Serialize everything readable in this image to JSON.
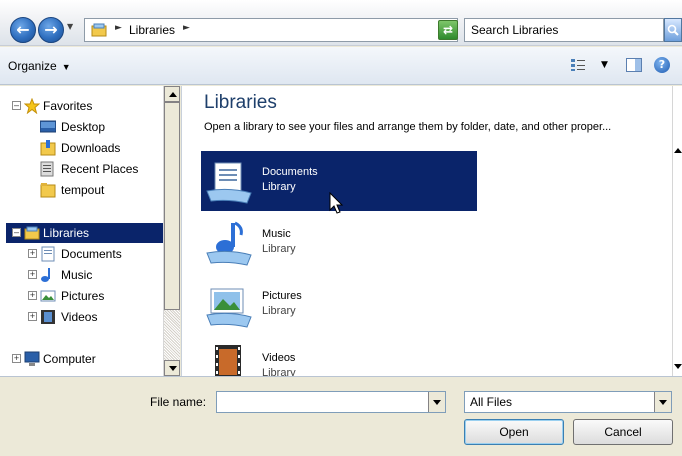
{
  "address": {
    "path_label": "Libraries",
    "search_placeholder": "Search Libraries"
  },
  "toolbar": {
    "organize_label": "Organize"
  },
  "nav": {
    "items": [
      {
        "label": "Favorites",
        "icon": "star-icon",
        "level": 0,
        "expander": "minus"
      },
      {
        "label": "Desktop",
        "icon": "desktop-icon",
        "level": 1
      },
      {
        "label": "Downloads",
        "icon": "downloads-folder-icon",
        "level": 1
      },
      {
        "label": "Recent Places",
        "icon": "recent-places-icon",
        "level": 1
      },
      {
        "label": "tempout",
        "icon": "folder-icon",
        "level": 1
      },
      {
        "label": "Libraries",
        "icon": "libraries-icon",
        "level": 0,
        "expander": "minus",
        "selected": true
      },
      {
        "label": "Documents",
        "icon": "documents-icon",
        "level": 1,
        "expander": "plus"
      },
      {
        "label": "Music",
        "icon": "music-icon",
        "level": 1,
        "expander": "plus"
      },
      {
        "label": "Pictures",
        "icon": "pictures-icon",
        "level": 1,
        "expander": "plus"
      },
      {
        "label": "Videos",
        "icon": "videos-icon",
        "level": 1,
        "expander": "plus"
      },
      {
        "label": "Computer",
        "icon": "computer-icon",
        "level": 0,
        "expander": "plus"
      }
    ]
  },
  "content": {
    "title": "Libraries",
    "subtitle": "Open a library to see your files and arrange them by folder, date, and other proper...",
    "libraries": [
      {
        "name": "Documents",
        "type": "Library",
        "icon": "documents-library-icon",
        "selected": true
      },
      {
        "name": "Music",
        "type": "Library",
        "icon": "music-library-icon"
      },
      {
        "name": "Pictures",
        "type": "Library",
        "icon": "pictures-library-icon"
      },
      {
        "name": "Videos",
        "type": "Library",
        "icon": "videos-library-icon"
      }
    ]
  },
  "bottom": {
    "filename_label": "File name:",
    "filename_value": "",
    "filter_value": "All Files",
    "open_label": "Open",
    "cancel_label": "Cancel"
  },
  "colors": {
    "selection": "#0a246a",
    "title_blue": "#1e3f6b",
    "chrome": "#ece9d8"
  }
}
